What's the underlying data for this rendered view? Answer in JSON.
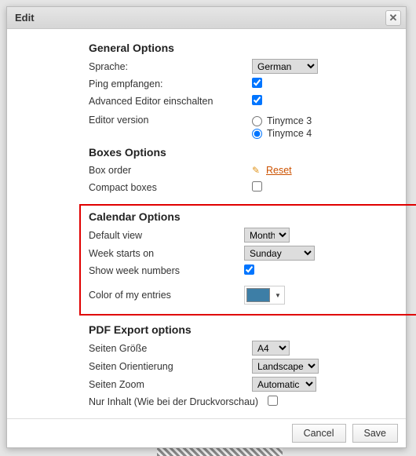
{
  "dialog": {
    "title": "Edit"
  },
  "sections": {
    "general": {
      "heading": "General Options",
      "language_label": "Sprache:",
      "language_value": "German",
      "language_options": [
        "German"
      ],
      "ping_label": "Ping empfangen:",
      "ping_checked": true,
      "adv_editor_label": "Advanced Editor einschalten",
      "adv_editor_checked": true,
      "editor_version_label": "Editor version",
      "editor_radios": [
        {
          "label": "Tinymce 3",
          "checked": false
        },
        {
          "label": "Tinymce 4",
          "checked": true
        }
      ]
    },
    "boxes": {
      "heading": "Boxes Options",
      "box_order_label": "Box order",
      "reset_label": "Reset",
      "compact_label": "Compact boxes",
      "compact_checked": false
    },
    "calendar": {
      "heading": "Calendar Options",
      "default_view_label": "Default view",
      "default_view_value": "Month",
      "week_starts_label": "Week starts on",
      "week_starts_value": "Sunday",
      "show_week_label": "Show week numbers",
      "show_week_checked": true,
      "color_entries_label": "Color of my entries",
      "color_entries_value": "#3d7ea6"
    },
    "pdf": {
      "heading": "PDF Export options",
      "page_size_label": "Seiten Größe",
      "page_size_value": "A4",
      "orientation_label": "Seiten Orientierung",
      "orientation_value": "Landscape",
      "zoom_label": "Seiten Zoom",
      "zoom_value": "Automatic",
      "only_content_label": "Nur Inhalt (Wie bei der Druckvorschau)",
      "only_content_checked": false
    }
  },
  "footer": {
    "cancel": "Cancel",
    "save": "Save"
  }
}
